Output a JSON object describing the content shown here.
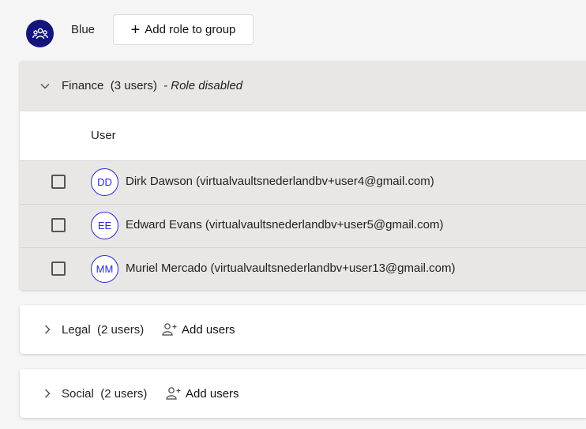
{
  "group": {
    "name": "Blue",
    "avatar_icon": "group-users-icon",
    "add_role_label": "Add role to group",
    "add_role_icon": "plus-icon",
    "colors": {
      "avatar_bg": "#14147a",
      "avatar_fg": "#ffffff"
    }
  },
  "roles": [
    {
      "name": "Finance",
      "count": "(3 users)",
      "status": "- Role disabled",
      "expanded": true,
      "column_header": "User",
      "users": [
        {
          "initials": "DD",
          "label": "Dirk Dawson (virtualvaultsnederlandbv+user4@gmail.com)"
        },
        {
          "initials": "EE",
          "label": "Edward Evans (virtualvaultsnederlandbv+user5@gmail.com)"
        },
        {
          "initials": "MM",
          "label": "Muriel Mercado (virtualvaultsnederlandbv+user13@gmail.com)"
        }
      ]
    },
    {
      "name": "Legal",
      "count": "(2 users)",
      "expanded": false,
      "add_users_label": "Add users"
    },
    {
      "name": "Social",
      "count": "(2 users)",
      "expanded": false,
      "add_users_label": "Add users"
    }
  ],
  "colors": {
    "disabled_section_bg": "#e8e7e5",
    "user_avatar_accent": "#2a2ad0",
    "page_bg": "#f5f5f5"
  }
}
